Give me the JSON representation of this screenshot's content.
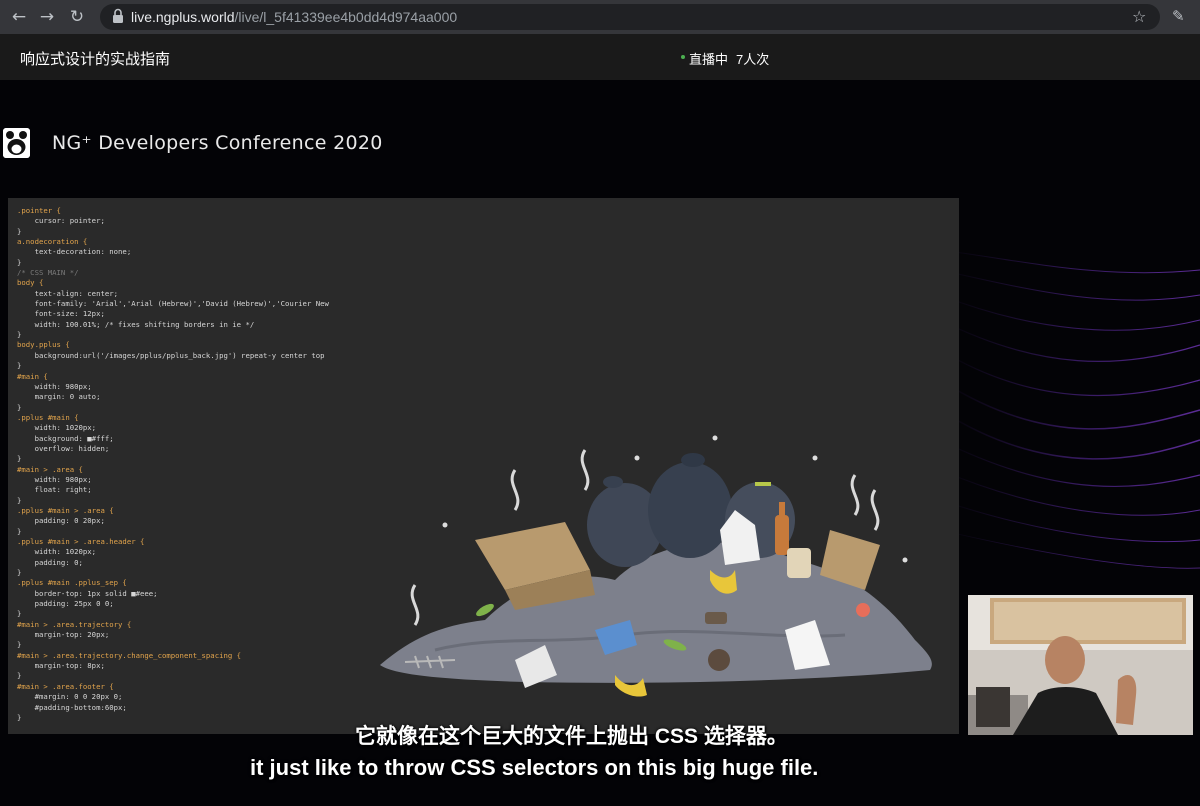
{
  "browser": {
    "back_icon": "←",
    "forward_icon": "→",
    "reload_icon": "↻",
    "url_host": "live.ngplus.world",
    "url_path": "/live/l_5f41339ee4b0dd4d974aa000",
    "star_icon": "☆",
    "extension_icon": "✎"
  },
  "page": {
    "title": "响应式设计的实战指南",
    "live_status": "直播中",
    "viewer_count": "7人次"
  },
  "video": {
    "conference_title": "NG⁺ Developers Conference 2020",
    "code_lines": [
      ".pointer {",
      "    cursor: pointer;",
      "}",
      "a.nodecoration {",
      "    text-decoration: none;",
      "}",
      "/* CSS MAIN */",
      "body {",
      "    text-align: center;",
      "    font-family: 'Arial','Arial (Hebrew)','David (Hebrew)','Courier New",
      "    font-size: 12px;",
      "    width: 100.01%; /* fixes shifting borders in ie */",
      "}",
      "body.pplus {",
      "    background:url('/images/pplus/pplus_back.jpg') repeat-y center top",
      "}",
      "#main {",
      "    width: 980px;",
      "    margin: 0 auto;",
      "}",
      ".pplus #main {",
      "    width: 1020px;",
      "    background: ■#fff;",
      "    overflow: hidden;",
      "}",
      "#main > .area {",
      "    width: 980px;",
      "    float: right;",
      "}",
      ".pplus #main > .area {",
      "    padding: 0 20px;",
      "}",
      ".pplus #main > .area.header {",
      "    width: 1020px;",
      "    padding: 0;",
      "}",
      ".pplus #main .pplus_sep {",
      "    border-top: 1px solid ■#eee;",
      "    padding: 25px 0 0;",
      "}",
      "#main > .area.trajectory {",
      "    margin-top: 20px;",
      "}",
      "#main > .area.trajectory.change_component_spacing {",
      "    margin-top: 8px;",
      "}",
      "#main > .area.footer {",
      "    #margin: 0 0 20px 0;",
      "    #padding-bottom:60px;",
      "}"
    ],
    "subtitle_cn": "它就像在这个巨大的文件上抛出 CSS 选择器。",
    "subtitle_en": "it just like to throw CSS selectors on this big huge file."
  }
}
